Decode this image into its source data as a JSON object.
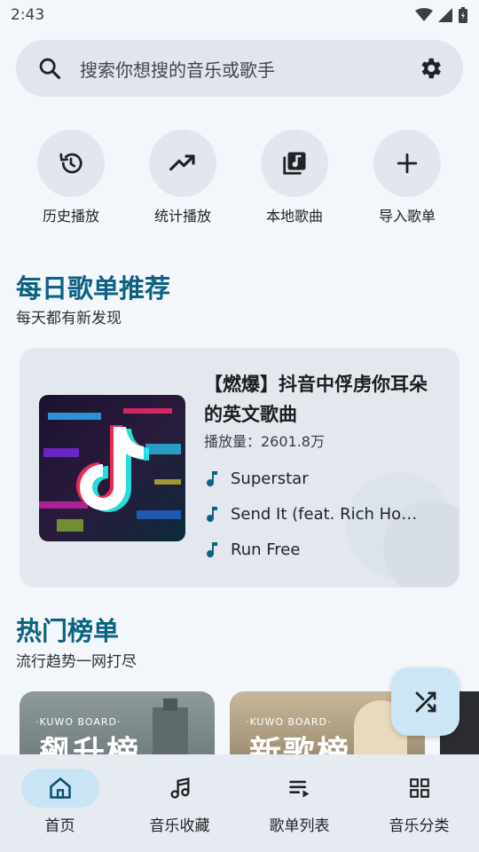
{
  "status_bar": {
    "time": "2:43"
  },
  "search": {
    "placeholder": "搜索你想搜的音乐或歌手"
  },
  "quick_actions": [
    {
      "label": "历史播放",
      "icon": "history-icon"
    },
    {
      "label": "统计播放",
      "icon": "trending-up-icon"
    },
    {
      "label": "本地歌曲",
      "icon": "library-music-icon"
    },
    {
      "label": "导入歌单",
      "icon": "plus-icon"
    }
  ],
  "daily": {
    "title": "每日歌单推荐",
    "subtitle": "每天都有新发现",
    "playlist": {
      "title": "【燃爆】抖音中俘虏你耳朵的英文歌曲",
      "plays": "播放量：2601.8万",
      "songs": [
        "Superstar",
        "Send It (feat. Rich Homie Quan)",
        "Run Free"
      ]
    }
  },
  "charts": {
    "title": "热门榜单",
    "subtitle": "流行趋势一网打尽",
    "boards": [
      {
        "big": "飙升榜",
        "brand": "·KUWO BOARD·"
      },
      {
        "big": "新歌榜",
        "brand": "·KUWO BOARD·"
      }
    ]
  },
  "fab": {
    "icon": "shuffle-icon"
  },
  "nav": [
    {
      "label": "首页",
      "icon": "home-icon",
      "active": true
    },
    {
      "label": "音乐收藏",
      "icon": "music-note-icon"
    },
    {
      "label": "歌单列表",
      "icon": "playlist-icon"
    },
    {
      "label": "音乐分类",
      "icon": "grid-icon"
    }
  ],
  "colors": {
    "accent": "#0d6283",
    "background": "#f3f7fc",
    "nav_active": "#c9e4f5",
    "fab": "#cde6f6"
  }
}
